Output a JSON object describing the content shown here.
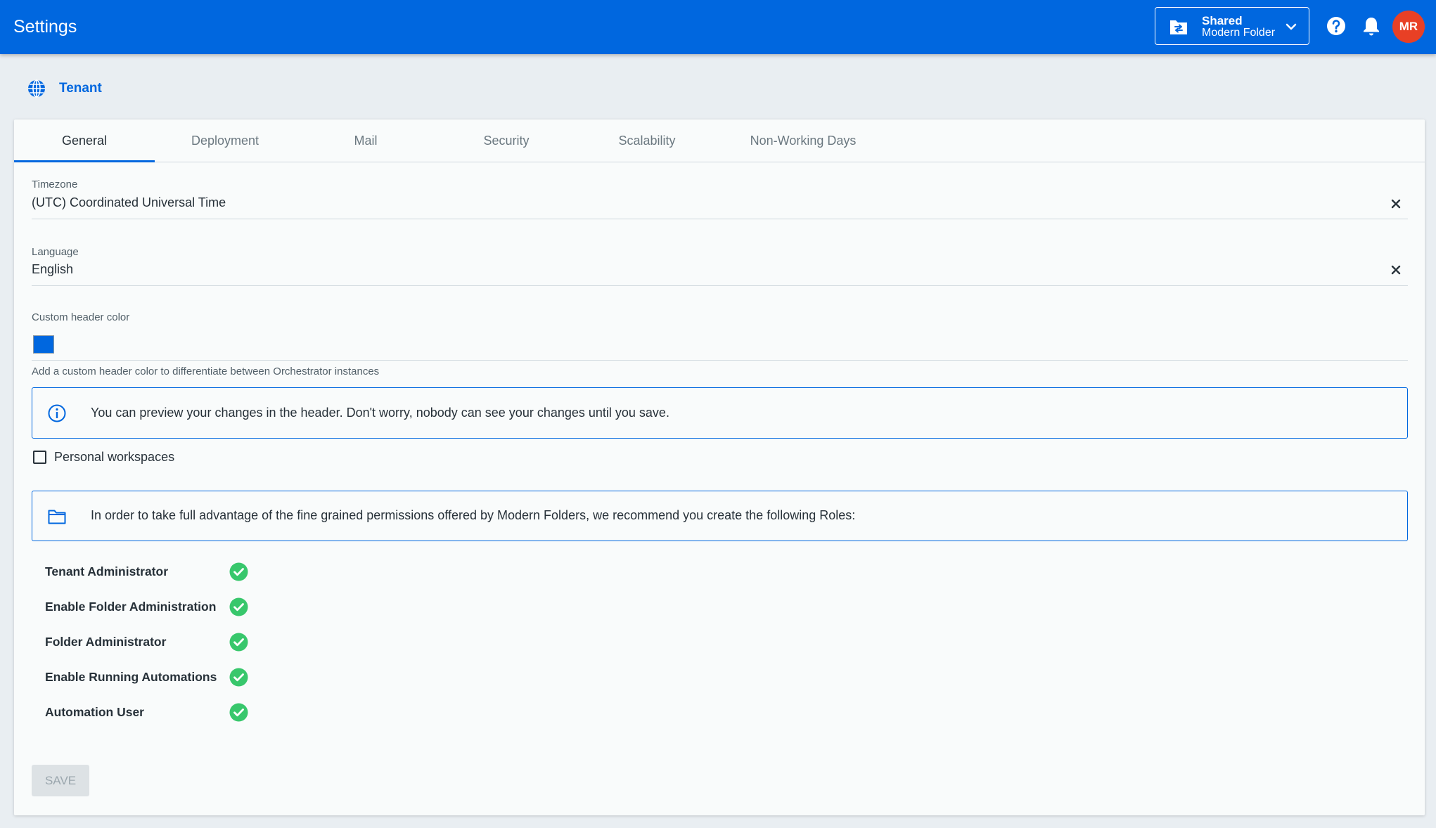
{
  "header": {
    "title": "Settings",
    "background_color": "#0067df",
    "folder_picker": {
      "line1": "Shared",
      "line2": "Modern Folder"
    },
    "avatar_initials": "MR",
    "avatar_color": "#e84025"
  },
  "breadcrumb": {
    "label": "Tenant"
  },
  "tabs": [
    {
      "label": "General",
      "active": true
    },
    {
      "label": "Deployment",
      "active": false
    },
    {
      "label": "Mail",
      "active": false
    },
    {
      "label": "Security",
      "active": false
    },
    {
      "label": "Scalability",
      "active": false
    },
    {
      "label": "Non-Working Days",
      "active": false
    }
  ],
  "form": {
    "timezone": {
      "label": "Timezone",
      "value": "(UTC) Coordinated Universal Time"
    },
    "language": {
      "label": "Language",
      "value": "English"
    },
    "header_color": {
      "label": "Custom header color",
      "value": "#0067df",
      "helper": "Add a custom header color to differentiate between Orchestrator instances"
    },
    "preview_info": "You can preview your changes in the header. Don't worry, nobody can see your changes until you save.",
    "personal_workspaces": {
      "label": "Personal workspaces",
      "checked": false
    },
    "roles_info": "In order to take full advantage of the fine grained permissions offered by Modern Folders, we recommend you create the following Roles:",
    "roles": [
      {
        "name": "Tenant Administrator",
        "status": "check-circle-icon"
      },
      {
        "name": "Enable Folder Administration",
        "status": "check-circle-icon"
      },
      {
        "name": "Folder Administrator",
        "status": "check-circle-icon"
      },
      {
        "name": "Enable Running Automations",
        "status": "check-circle-icon"
      },
      {
        "name": "Automation User",
        "status": "check-circle-icon"
      }
    ],
    "save_label": "Save"
  }
}
